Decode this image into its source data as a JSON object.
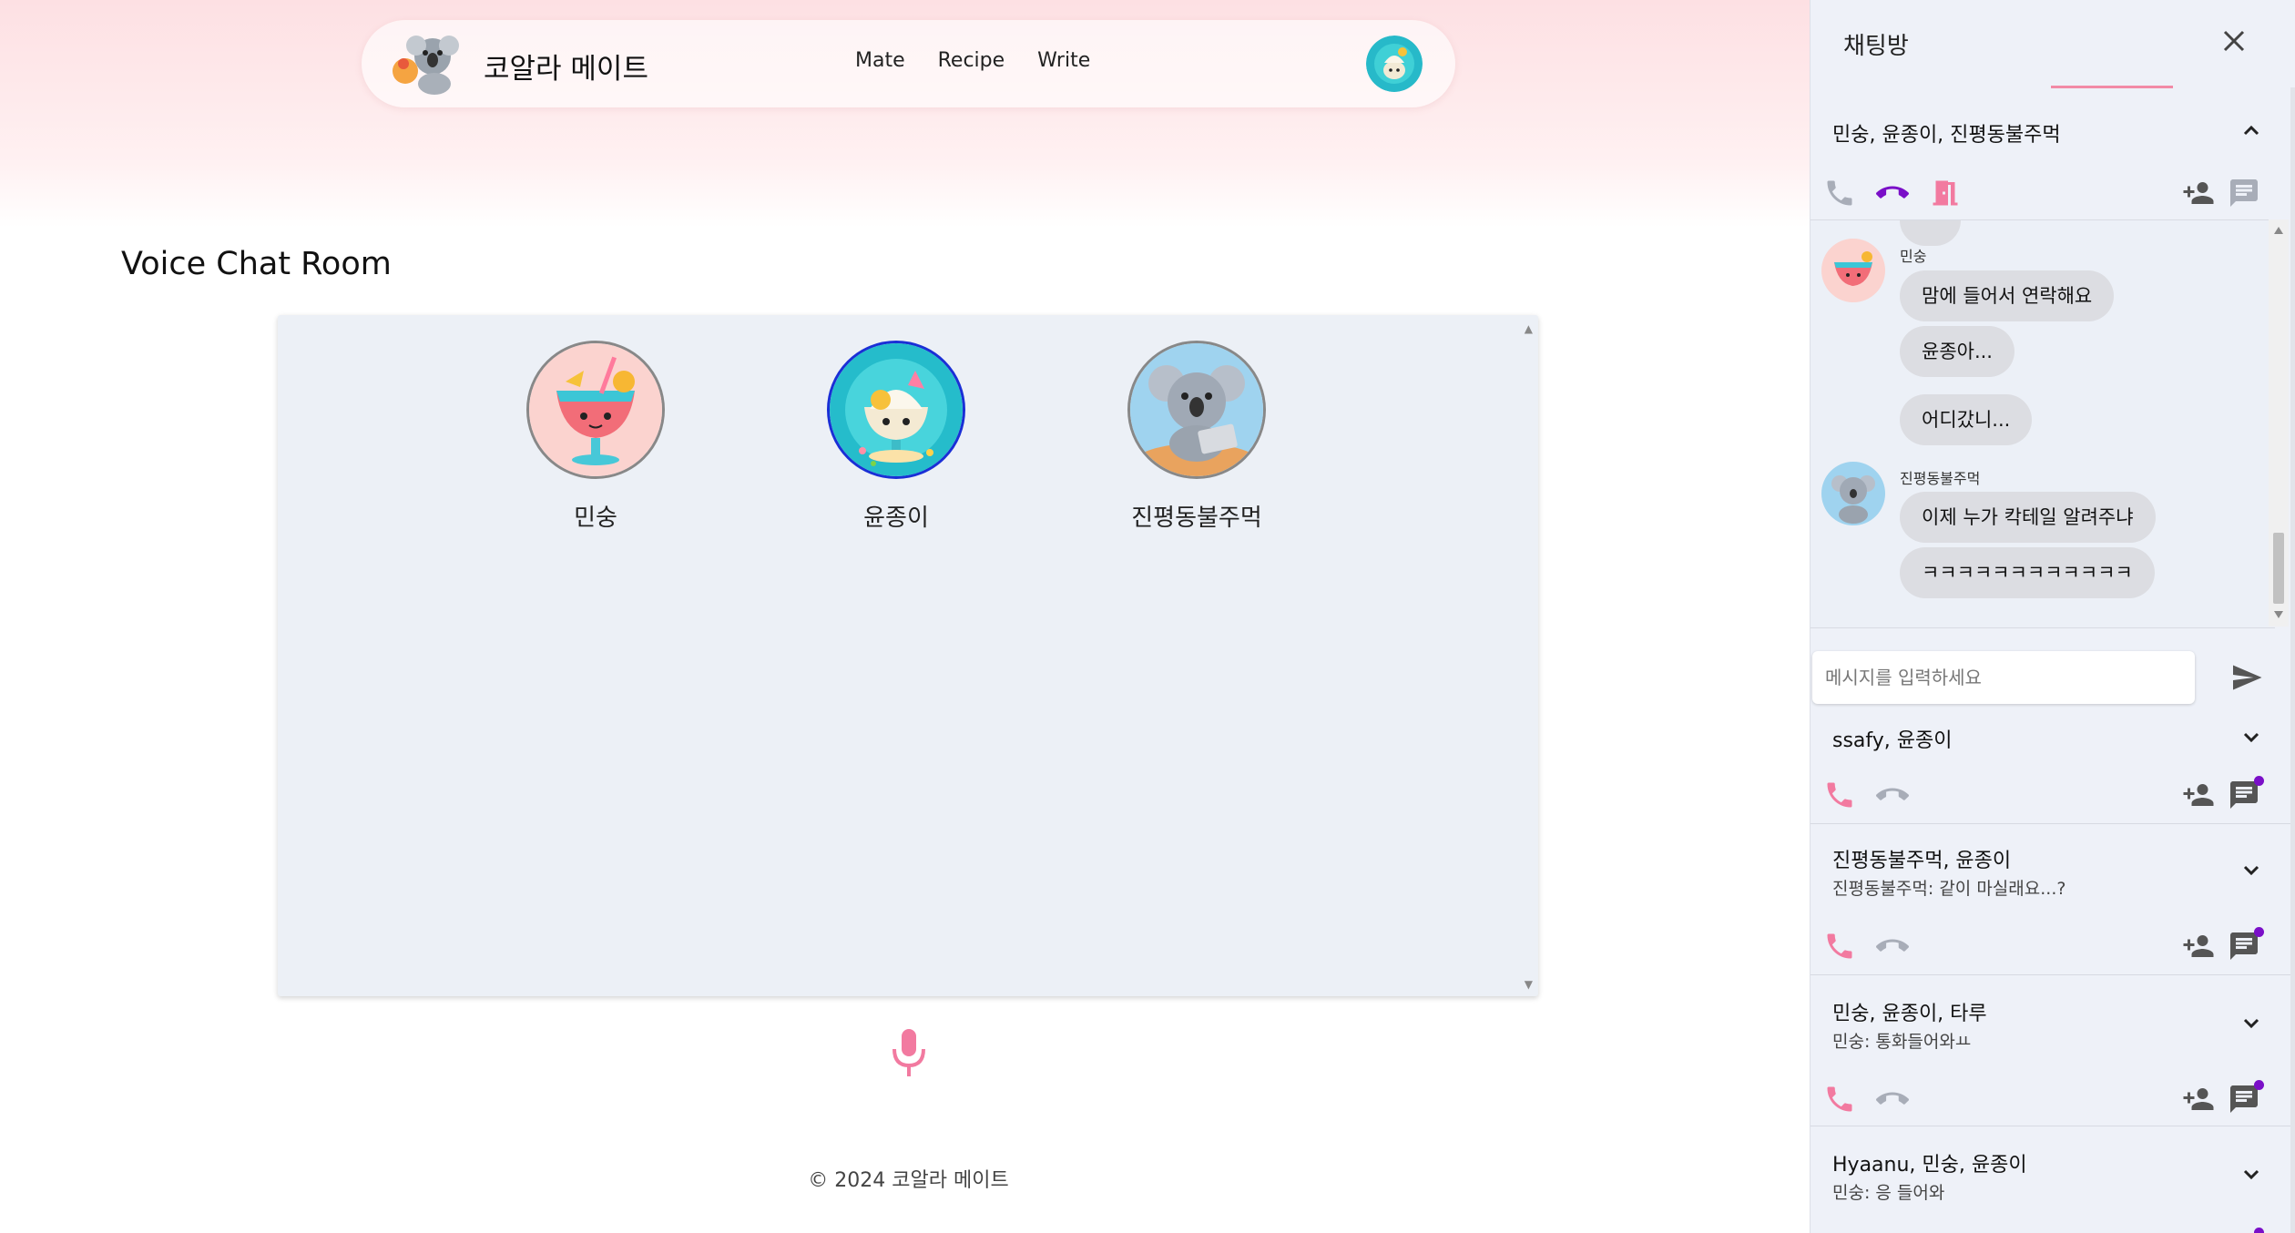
{
  "header": {
    "brand_name": "코알라 메이트",
    "nav": [
      "Mate",
      "Recipe",
      "Write"
    ]
  },
  "main": {
    "title": "Voice Chat Room",
    "participants": [
      {
        "name": "민숭",
        "speaking": false
      },
      {
        "name": "윤종이",
        "speaking": true
      },
      {
        "name": "진평동불주먹",
        "speaking": false
      }
    ]
  },
  "footer": {
    "text": "© 2024 코알라 메이트"
  },
  "sidebar": {
    "title": "채팅방",
    "active_room": {
      "title": "민숭, 윤종이, 진평동불주먹",
      "messages": [
        {
          "sender": "민숭",
          "bubbles": [
            "맘에 들어서 연락해요",
            "윤종아...",
            "어디갔니..."
          ]
        },
        {
          "sender": "진평동불주먹",
          "bubbles": [
            "이제 누가 칵테일 알려주냐",
            "ㅋㅋㅋㅋㅋㅋㅋㅋㅋㅋㅋㅋ"
          ]
        }
      ],
      "input_placeholder": "메시지를 입력하세요"
    },
    "rooms": [
      {
        "title": "ssafy, 윤종이",
        "preview": ""
      },
      {
        "title": "진평동불주먹, 윤종이",
        "preview": "진평동불주먹: 같이 마실래요...?"
      },
      {
        "title": "민숭, 윤종이, 타루",
        "preview": "민숭: 통화들어와ㅛ"
      },
      {
        "title": "Hyaanu, 민숭, 윤종이",
        "preview": "민숭: 응 들어와"
      }
    ]
  },
  "colors": {
    "accent_pink": "#f27aa0",
    "unread_dot": "#7a0fc8",
    "speaking_border": "#1a2fd6"
  }
}
